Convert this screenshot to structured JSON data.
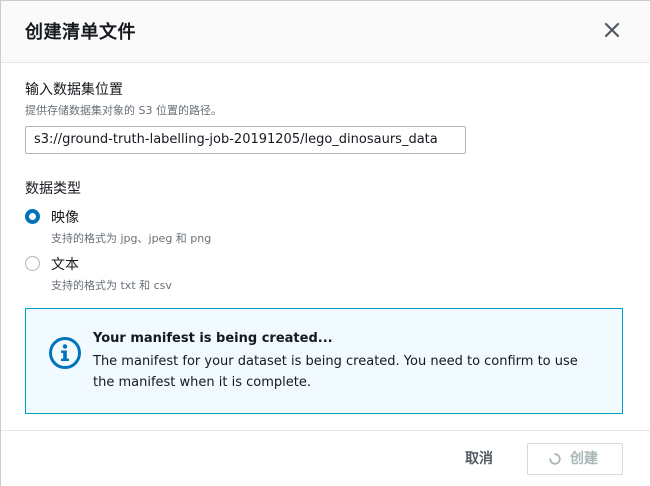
{
  "header": {
    "title": "创建清单文件",
    "close_icon": "close-icon"
  },
  "location": {
    "label": "输入数据集位置",
    "description": "提供存储数据集对象的 S3 位置的路径。",
    "value": "s3://ground-truth-labelling-job-20191205/lego_dinosaurs_data"
  },
  "data_type": {
    "label": "数据类型",
    "options": [
      {
        "title": "映像",
        "description": "支持的格式为 jpg、jpeg 和 png",
        "checked": true
      },
      {
        "title": "文本",
        "description": "支持的格式为 txt 和 csv",
        "checked": false
      }
    ]
  },
  "alert": {
    "icon": "info-icon",
    "title": "Your manifest is being created...",
    "text": "The manifest for your dataset is being created. You need to confirm to use the manifest when it is complete."
  },
  "footer": {
    "cancel_label": "取消",
    "create_label": "创建",
    "create_icon": "spinner-icon"
  },
  "colors": {
    "accent": "#0073bb",
    "alert_border": "#00a1c9",
    "alert_bg": "#f1faff",
    "disabled_text": "#aab7b8"
  }
}
